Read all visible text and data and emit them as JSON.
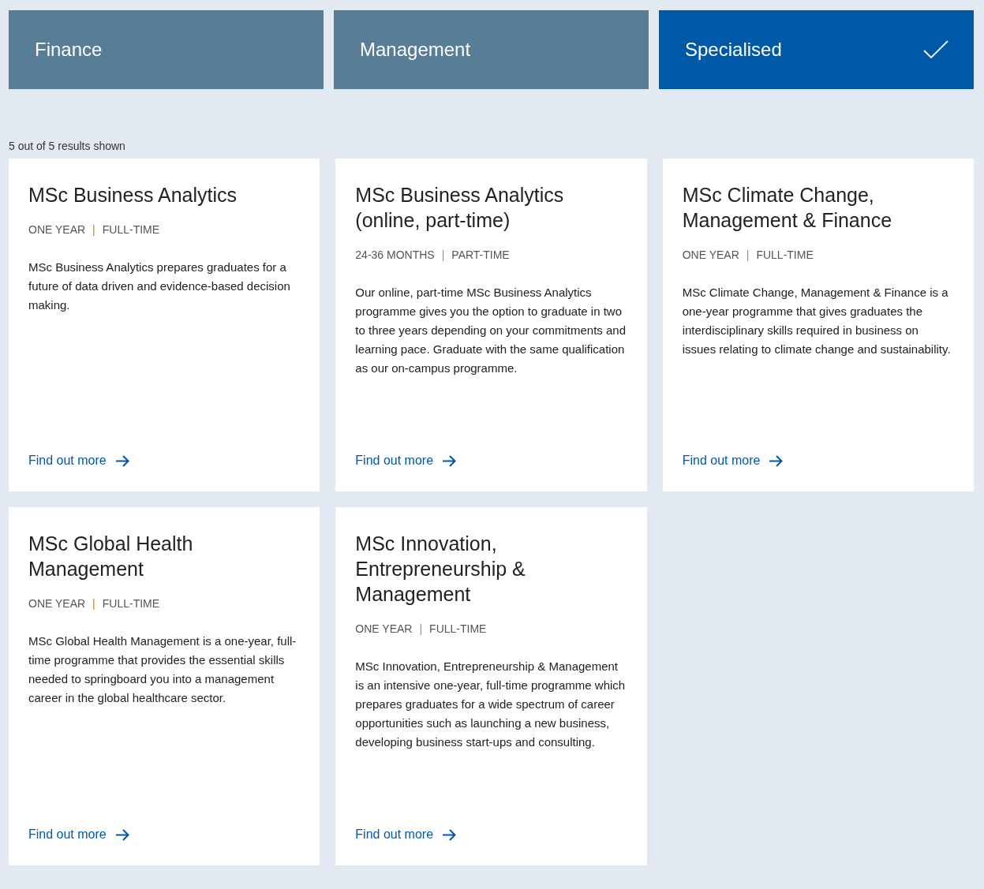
{
  "filters": [
    {
      "label": "Finance",
      "selected": false
    },
    {
      "label": "Management",
      "selected": false
    },
    {
      "label": "Specialised",
      "selected": true
    }
  ],
  "results_count": "5 out of 5 results shown",
  "courses": [
    {
      "title": "MSc Business Analytics",
      "duration": "ONE YEAR",
      "separator": "|",
      "mode": "FULL-TIME",
      "description": "MSc Business Analytics prepares graduates for a future of data driven and evidence-based decision making.",
      "link": "Find out more"
    },
    {
      "title": "MSc Business Analytics (online, part-time)",
      "duration": "24-36 MONTHS",
      "separator": "|",
      "mode": "PART-TIME",
      "description": "Our online, part-time MSc Business Analytics programme gives you the option to graduate in two to three years depending on your commitments and learning pace. Graduate with the same qualification as our on-campus programme.",
      "link": "Find out more"
    },
    {
      "title": "MSc Climate Change, Management & Finance",
      "duration": "ONE YEAR",
      "separator": "|",
      "mode": "FULL-TIME",
      "description": "MSc Climate Change, Management & Finance is a one-year programme that gives graduates the interdisciplinary skills required in business on issues relating to climate change and sustainability.",
      "link": "Find out more"
    },
    {
      "title": "MSc Global Health Management",
      "duration": "ONE YEAR",
      "separator": "|",
      "mode": "FULL-TIME",
      "description": "MSc Global Health Management is a one-year, full-time programme that provides the essential skills needed to springboard you into a management career in the global healthcare sector.",
      "link": "Find out more"
    },
    {
      "title": "MSc Innovation, Entrepreneurship & Management",
      "duration": "ONE YEAR",
      "separator": "|",
      "mode": "FULL-TIME",
      "description": "MSc Innovation, Entrepreneurship & Management is an intensive one-year, full-time programme which prepares graduates for a wide spectrum of career opportunities such as launching a new business, developing business start-ups and consulting.",
      "link": "Find out more"
    }
  ]
}
